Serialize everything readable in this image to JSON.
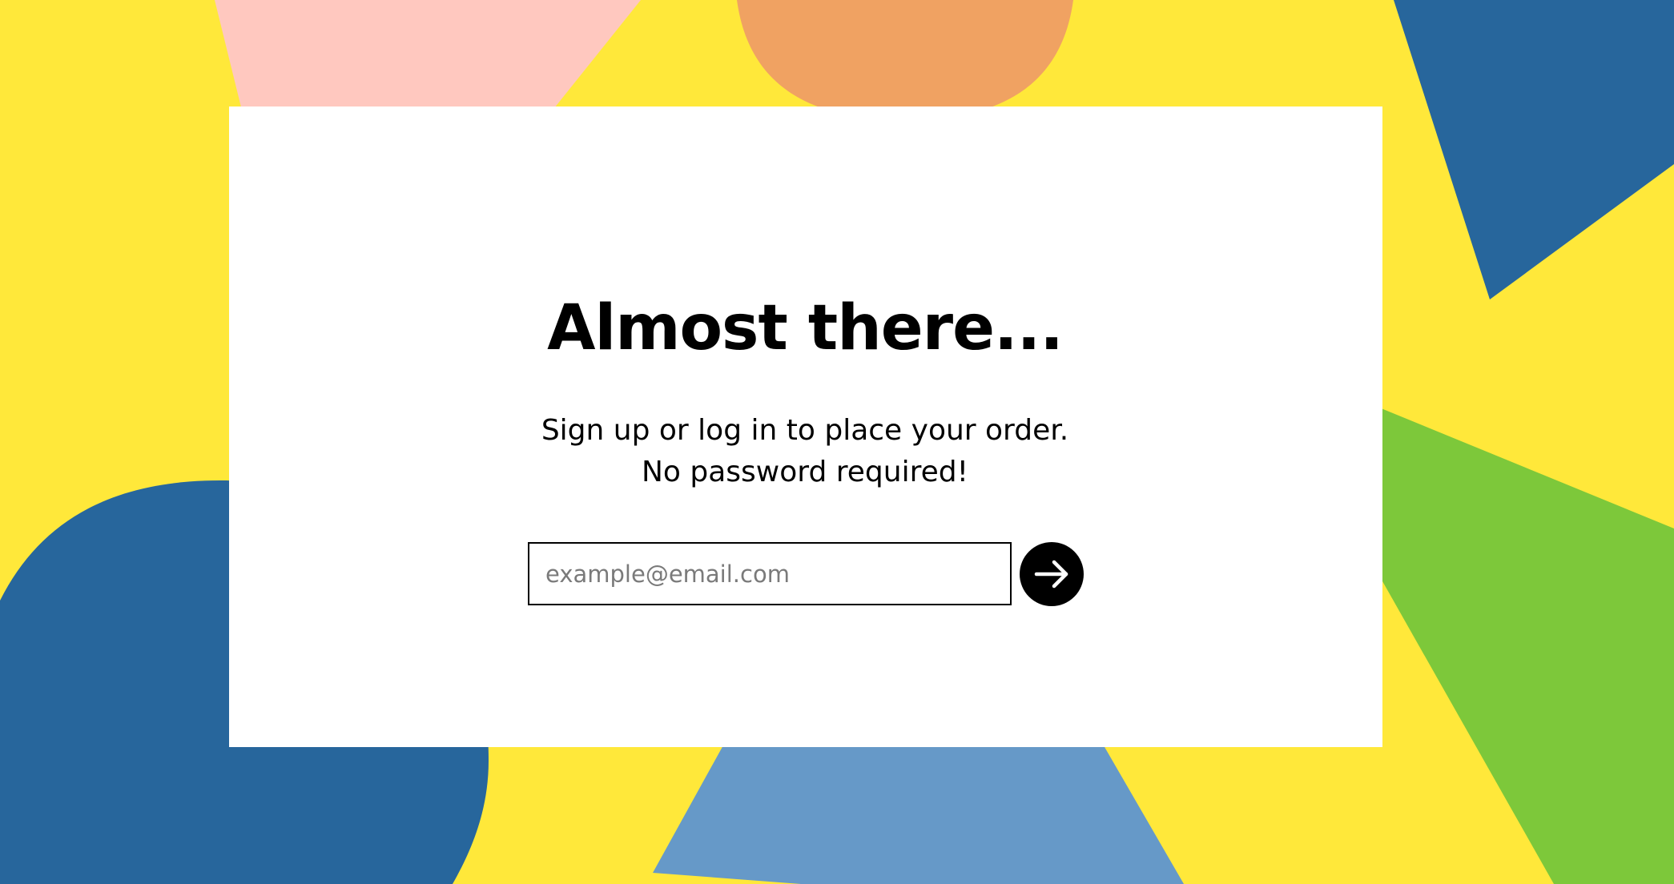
{
  "colors": {
    "background": "#FFE83A",
    "card": "#FFFFFF",
    "pink_shape": "#FFC8BF",
    "orange_shape": "#F0A262",
    "dark_blue_shape": "#27669C",
    "light_blue_shape": "#6699C8",
    "green_shape": "#7DC83A",
    "text": "#000000",
    "button": "#000000"
  },
  "signup": {
    "headline": "Almost there...",
    "subtext_line1": "Sign up or log in to place your order.",
    "subtext_line2": "No password required!",
    "email_placeholder": "example@email.com",
    "email_value": "",
    "submit_icon": "arrow-right-icon"
  }
}
